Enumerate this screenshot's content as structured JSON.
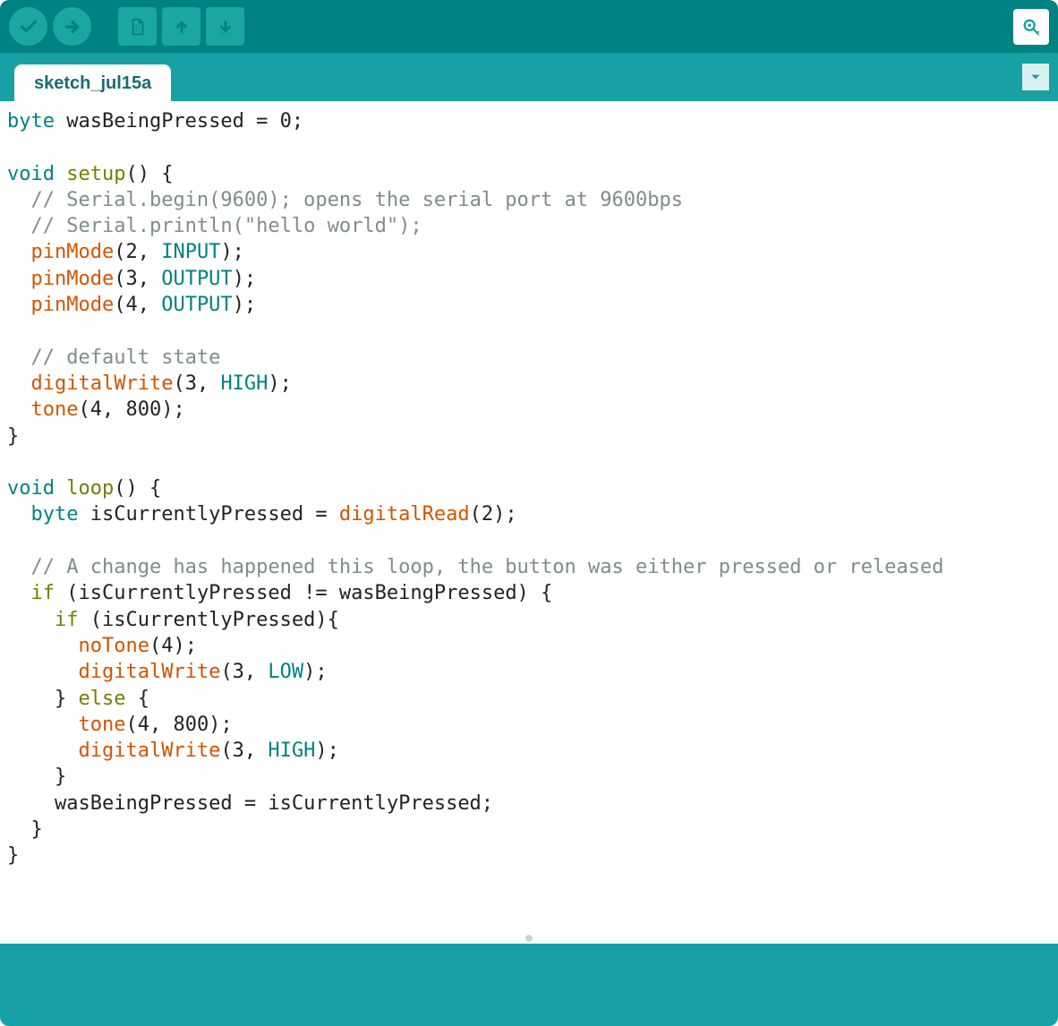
{
  "tab": {
    "name": "sketch_jul15a"
  },
  "toolbar": {
    "verify": "Verify",
    "upload": "Upload",
    "new": "New",
    "open": "Open",
    "save": "Save",
    "monitor": "Serial Monitor"
  },
  "code": {
    "l01a": "byte",
    "l01b": " wasBeingPressed = 0;",
    "l02": "",
    "l03a": "void",
    "l03b": " ",
    "l03c": "setup",
    "l03d": "() {",
    "l04a": "  ",
    "l04b": "// Serial.begin(9600); opens the serial port at 9600bps",
    "l05a": "  ",
    "l05b": "// Serial.println(\"hello world\");",
    "l06a": "  ",
    "l06b": "pinMode",
    "l06c": "(2, ",
    "l06d": "INPUT",
    "l06e": ");",
    "l07a": "  ",
    "l07b": "pinMode",
    "l07c": "(3, ",
    "l07d": "OUTPUT",
    "l07e": ");",
    "l08a": "  ",
    "l08b": "pinMode",
    "l08c": "(4, ",
    "l08d": "OUTPUT",
    "l08e": ");",
    "l09": "",
    "l10a": "  ",
    "l10b": "// default state",
    "l11a": "  ",
    "l11b": "digitalWrite",
    "l11c": "(3, ",
    "l11d": "HIGH",
    "l11e": ");",
    "l12a": "  ",
    "l12b": "tone",
    "l12c": "(4, 800);",
    "l13": "}",
    "l14": "",
    "l15a": "void",
    "l15b": " ",
    "l15c": "loop",
    "l15d": "() {",
    "l16a": "  ",
    "l16b": "byte",
    "l16c": " isCurrentlyPressed = ",
    "l16d": "digitalRead",
    "l16e": "(2);",
    "l17": "",
    "l18a": "  ",
    "l18b": "// A change has happened this loop, the button was either pressed or released",
    "l19a": "  ",
    "l19b": "if",
    "l19c": " (isCurrentlyPressed != wasBeingPressed) {",
    "l20a": "    ",
    "l20b": "if",
    "l20c": " (isCurrentlyPressed){",
    "l21a": "      ",
    "l21b": "noTone",
    "l21c": "(4);",
    "l22a": "      ",
    "l22b": "digitalWrite",
    "l22c": "(3, ",
    "l22d": "LOW",
    "l22e": ");",
    "l23a": "    } ",
    "l23b": "else",
    "l23c": " {",
    "l24a": "      ",
    "l24b": "tone",
    "l24c": "(4, 800);",
    "l25a": "      ",
    "l25b": "digitalWrite",
    "l25c": "(3, ",
    "l25d": "HIGH",
    "l25e": ");",
    "l26": "    }",
    "l27": "    wasBeingPressed = isCurrentlyPressed;",
    "l28": "  }",
    "l29": "}"
  }
}
